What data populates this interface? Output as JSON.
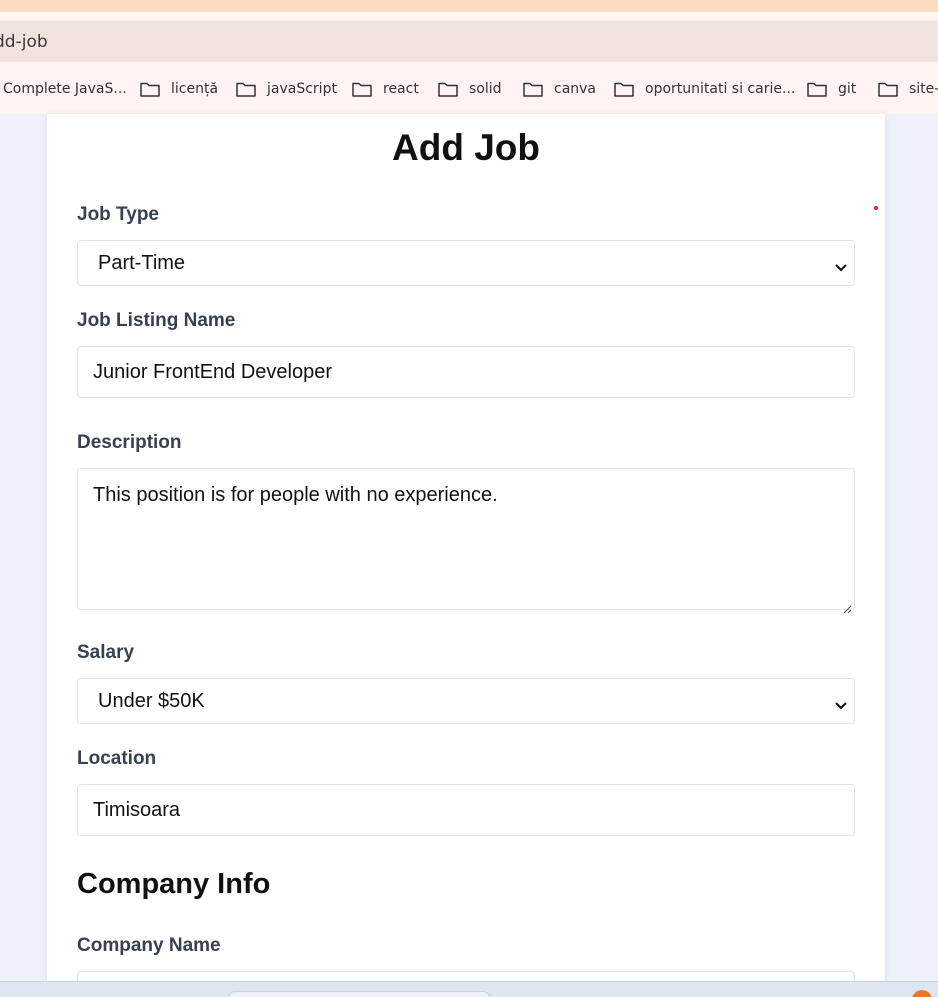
{
  "browser": {
    "url": "dd-job",
    "bookmarks": [
      {
        "label": "Complete JavaS...",
        "has_folder_icon": false
      },
      {
        "label": "licență",
        "has_folder_icon": true
      },
      {
        "label": "javaScript",
        "has_folder_icon": true
      },
      {
        "label": "react",
        "has_folder_icon": true
      },
      {
        "label": "solid",
        "has_folder_icon": true
      },
      {
        "label": "canva",
        "has_folder_icon": true
      },
      {
        "label": "oportunitati si carie...",
        "has_folder_icon": true
      },
      {
        "label": "git",
        "has_folder_icon": true
      },
      {
        "label": "site-",
        "has_folder_icon": true
      }
    ]
  },
  "form": {
    "title": "Add Job",
    "job_type": {
      "label": "Job Type",
      "value": "Part-Time"
    },
    "job_listing_name": {
      "label": "Job Listing Name",
      "value": "Junior FrontEnd Developer"
    },
    "description": {
      "label": "Description",
      "value": "This position is for people with no experience."
    },
    "salary": {
      "label": "Salary",
      "value": "Under $50K"
    },
    "location": {
      "label": "Location",
      "value": "Timisoara"
    },
    "company_info": {
      "heading": "Company Info"
    },
    "company_name": {
      "label": "Company Name",
      "value": ""
    }
  },
  "colors": {
    "page_background": "#eef1fb",
    "card_background": "#ffffff",
    "label_text": "#374151",
    "field_border": "#e2e4e8",
    "accent_dot": "#e0202a"
  }
}
